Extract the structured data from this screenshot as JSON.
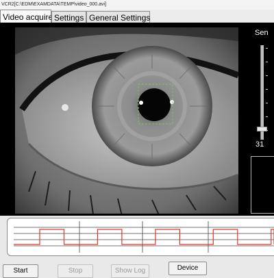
{
  "window": {
    "title": "VCR2[C:\\EDM\\EXAMDATA\\TEMP\\video_000.avi]"
  },
  "tabs": [
    {
      "label": "Video acquire",
      "active": true
    },
    {
      "label": "Settings",
      "active": false
    },
    {
      "label": "General Settings",
      "active": false
    }
  ],
  "sensitivity": {
    "label": "Sen",
    "value": "31",
    "level_fraction": 0.09
  },
  "signal_graph": {
    "line_color": "#e0342a",
    "pulses": 5
  },
  "buttons": {
    "start": "Start",
    "stop": "Stop",
    "show_log": "Show Log",
    "device": "Device"
  },
  "colors": {
    "tracking_box": "#7fbf6a",
    "panel_bg": "#000000"
  },
  "icons": {
    "pupil_marker": "dashed-square"
  }
}
